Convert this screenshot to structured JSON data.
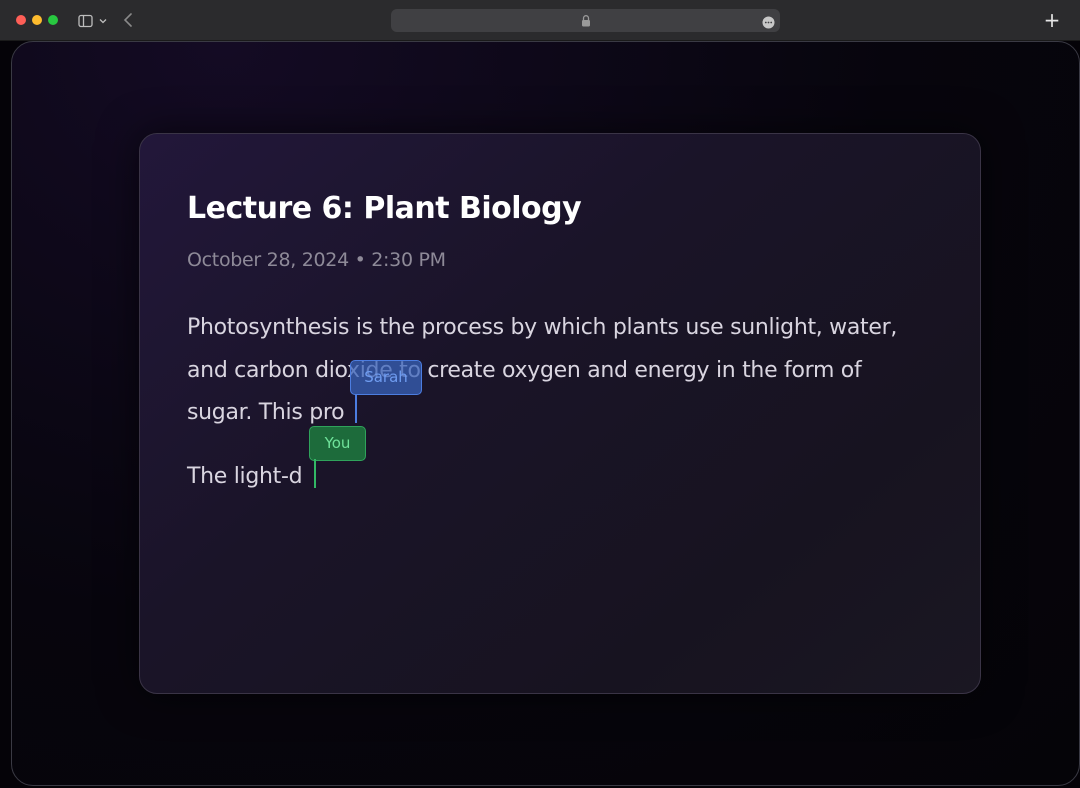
{
  "browser": {
    "address_icon": "lock-icon",
    "new_tab_label": "+"
  },
  "note": {
    "title": "Lecture 6: Plant Biology",
    "meta": "October 28, 2024 • 2:30 PM",
    "paragraph1_line1": "Photosynthesis is the process by which plants use sunlight, water,",
    "paragraph1_line2": "and carbon dioxide to create oxygen and energy in the form of",
    "paragraph1_line3": "sugar. This pro",
    "paragraph2_line1": "The light-d"
  },
  "collaborators": [
    {
      "name": "Sarah",
      "color": "#4c7de0"
    },
    {
      "name": "You",
      "color": "#32b865"
    }
  ]
}
